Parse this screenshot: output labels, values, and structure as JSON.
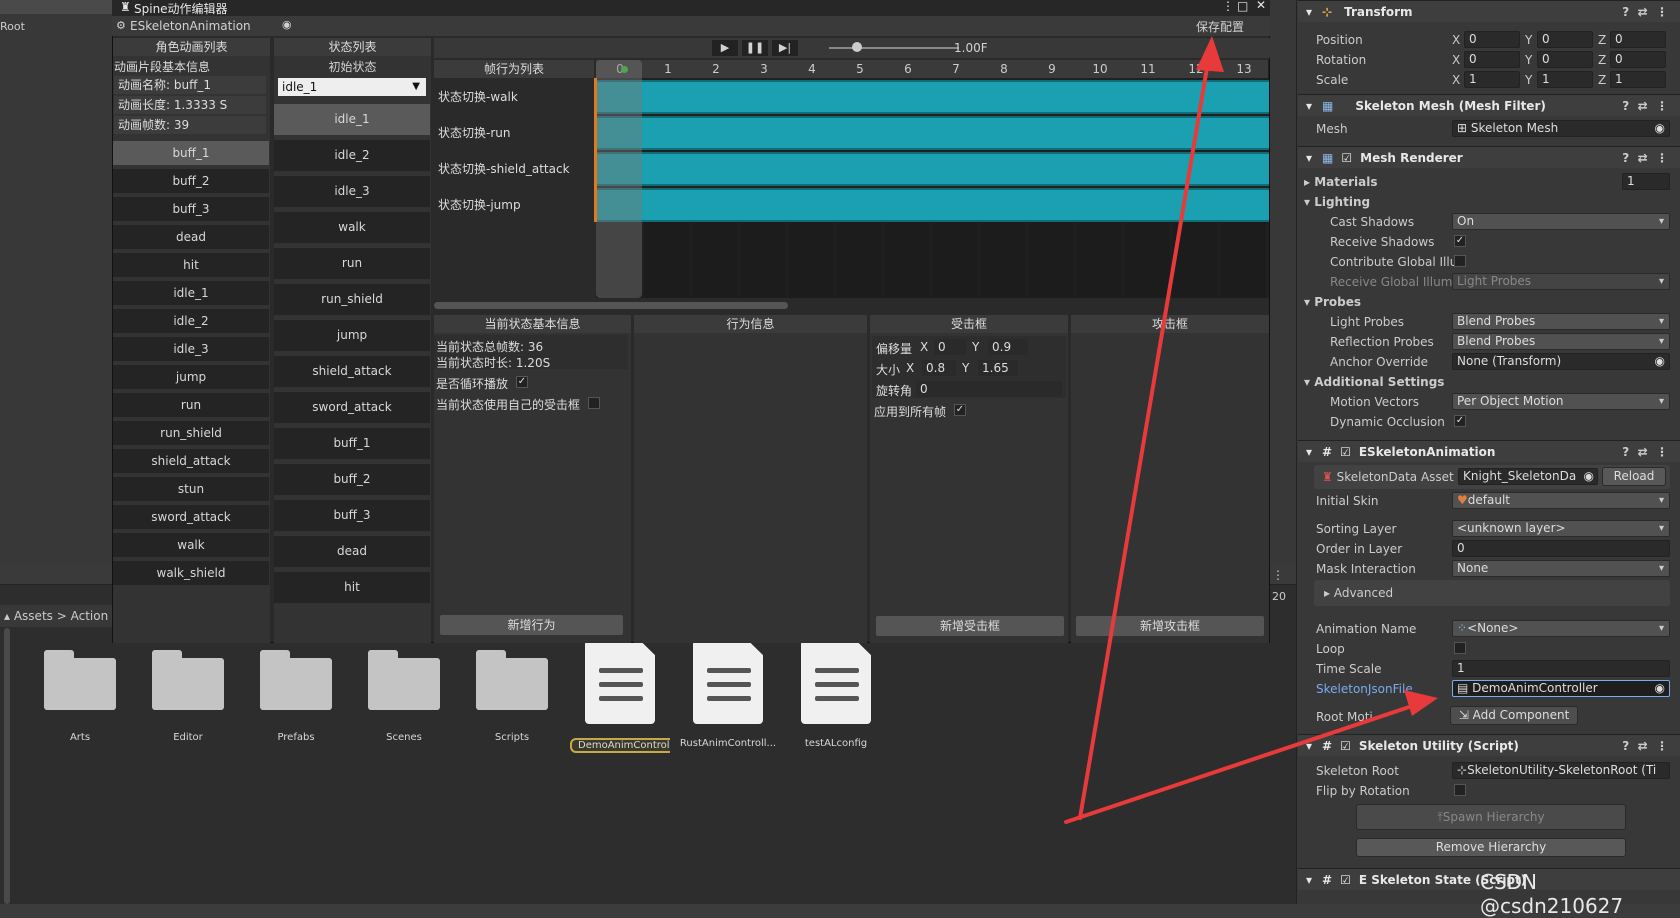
{
  "hierarchy": {
    "root": "Root"
  },
  "window": {
    "title": "Spine动作编辑器",
    "tab": "ESkeletonAnimation",
    "save": "保存配置"
  },
  "left": {
    "header": "角色动画列表",
    "info_title": "动画片段基本信息",
    "name": "动画名称: buff_1",
    "length": "动画长度: 1.3333 S",
    "frames": "动画帧数: 39",
    "items": [
      "buff_1",
      "buff_2",
      "buff_3",
      "dead",
      "hit",
      "idle_1",
      "idle_2",
      "idle_3",
      "jump",
      "run",
      "run_shield",
      "shield_attack",
      "stun",
      "sword_attack",
      "walk",
      "walk_shield"
    ]
  },
  "states": {
    "header": "状态列表",
    "initial": "初始状态",
    "initial_value": "idle_1",
    "items": [
      "idle_1",
      "idle_2",
      "idle_3",
      "walk",
      "run",
      "run_shield",
      "jump",
      "shield_attack",
      "sword_attack",
      "buff_1",
      "buff_2",
      "buff_3",
      "dead",
      "hit"
    ]
  },
  "timeline": {
    "speed": "1.00F",
    "header": "帧行为列表",
    "frames": [
      "0",
      "1",
      "2",
      "3",
      "4",
      "5",
      "6",
      "7",
      "8",
      "9",
      "10",
      "11",
      "12",
      "13"
    ],
    "tracks": [
      "状态切换-walk",
      "状态切换-run",
      "状态切换-shield_attack",
      "状态切换-jump"
    ]
  },
  "panels": {
    "basic": {
      "header": "当前状态基本信息",
      "total": "当前状态总帧数: 36",
      "duration": "当前状态时长: 1.20S",
      "loop": "是否循环播放",
      "own_hitbox": "当前状态使用自己的受击框",
      "btn": "新增行为"
    },
    "behavior": {
      "header": "行为信息"
    },
    "hitbox": {
      "header": "受击框",
      "offset": "偏移量",
      "ox": "0",
      "oy": "0.9",
      "size": "大小",
      "sx": "0.8",
      "sy": "1.65",
      "rot": "旋转角",
      "rv": "0",
      "apply": "应用到所有帧",
      "btn": "新增受击框",
      "x": "X",
      "y": "Y"
    },
    "attack": {
      "header": "攻击框",
      "btn": "新增攻击框"
    }
  },
  "project": {
    "crumb1": "Assets",
    "crumb2": "Action",
    "count": "20",
    "assets": [
      {
        "name": "Arts",
        "type": "folder"
      },
      {
        "name": "Editor",
        "type": "folder"
      },
      {
        "name": "Prefabs",
        "type": "folder"
      },
      {
        "name": "Scenes",
        "type": "folder"
      },
      {
        "name": "Scripts",
        "type": "folder"
      },
      {
        "name": "DemoAnimControl...",
        "type": "doc"
      },
      {
        "name": "RustAnimControll...",
        "type": "doc"
      },
      {
        "name": "testALconfig",
        "type": "doc"
      }
    ]
  },
  "inspector": {
    "transform": "Transform",
    "position": "Position",
    "rotation": "Rotation",
    "scale": "Scale",
    "pos": [
      "0",
      "0",
      "0"
    ],
    "rot": [
      "0",
      "0",
      "0"
    ],
    "scl": [
      "1",
      "1",
      "1"
    ],
    "x": "X",
    "y": "Y",
    "z": "Z",
    "meshfilter": "Skeleton Mesh (Mesh Filter)",
    "mesh": "Mesh",
    "mesh_v": "Skeleton Mesh",
    "renderer": "Mesh Renderer",
    "materials": "Materials",
    "materials_v": "1",
    "lighting": "Lighting",
    "cast": "Cast Shadows",
    "cast_v": "On",
    "receive": "Receive Shadows",
    "contrib": "Contribute Global Illur",
    "recgi": "Receive Global Illumi",
    "recgi_v": "Light Probes",
    "probes": "Probes",
    "lp": "Light Probes",
    "lp_v": "Blend Probes",
    "rp": "Reflection Probes",
    "rp_v": "Blend Probes",
    "ao": "Anchor Override",
    "ao_v": "None (Transform)",
    "additional": "Additional Settings",
    "mv": "Motion Vectors",
    "mv_v": "Per Object Motion",
    "dyn": "Dynamic Occlusion",
    "esa": "ESkeletonAnimation",
    "sda": "SkeletonData Asset",
    "sda_v": "Knight_SkeletonDa",
    "reload": "Reload",
    "skin": "Initial Skin",
    "skin_v": "default",
    "sort": "Sorting Layer",
    "sort_v": "<unknown layer>",
    "order": "Order in Layer",
    "order_v": "0",
    "mask": "Mask Interaction",
    "mask_v": "None",
    "advanced": "Advanced",
    "anim": "Animation Name",
    "anim_v": "<None>",
    "loop": "Loop",
    "ts": "Time Scale",
    "ts_v": "1",
    "json": "SkeletonJsonFile",
    "json_v": "DemoAnimController",
    "rootm": "Root Moti",
    "addcomp": "Add Component",
    "util": "Skeleton Utility (Script)",
    "sroot": "Skeleton Root",
    "sroot_v": "SkeletonUtility-SkeletonRoot (Ti",
    "flip": "Flip by Rotation",
    "spawn": "Spawn Hierarchy",
    "remove": "Remove Hierarchy",
    "estate": "E Skeleton State (Script)",
    "watermark": "CSDN @csdn210627"
  }
}
